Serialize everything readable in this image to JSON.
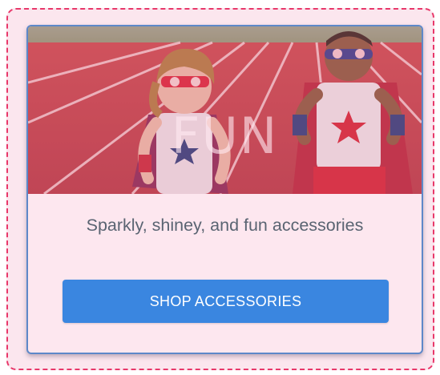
{
  "card": {
    "hero_title": "FUN",
    "tagline": "Sparkly, shiney, and fun accessories",
    "button_label": "SHOP ACCESSORIES"
  },
  "colors": {
    "frame_border": "#e8386a",
    "card_bg": "#fde7ef",
    "card_border": "#5d88c9",
    "button_bg": "#3a86e0",
    "button_text": "#ffffff",
    "tagline_text": "#5a6472"
  },
  "icons": {
    "hero_image": "kids-superhero-running-track-photo"
  }
}
